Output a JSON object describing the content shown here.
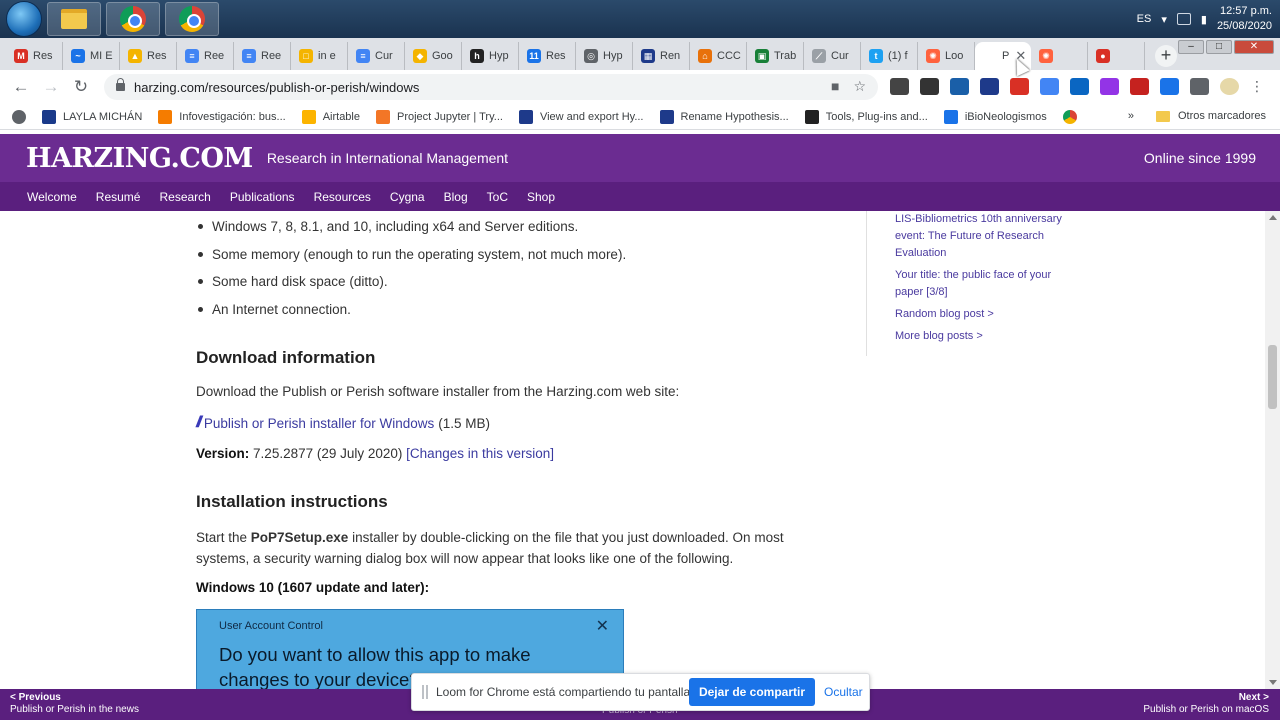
{
  "taskbar": {
    "language": "ES",
    "time": "12:57 p.m.",
    "date": "25/08/2020"
  },
  "tabs": [
    {
      "label": "Res",
      "color": "#d93025",
      "glyph": "M"
    },
    {
      "label": "MI E",
      "color": "#1a73e8",
      "glyph": "~"
    },
    {
      "label": "Res",
      "color": "#f4b400",
      "glyph": "▲"
    },
    {
      "label": "Ree",
      "color": "#4285f4",
      "glyph": "≡"
    },
    {
      "label": "Ree",
      "color": "#4285f4",
      "glyph": "≡"
    },
    {
      "label": "in e",
      "color": "#f4b400",
      "glyph": "□"
    },
    {
      "label": "Cur",
      "color": "#4285f4",
      "glyph": "≡"
    },
    {
      "label": "Goo",
      "color": "#f4b400",
      "glyph": "◆"
    },
    {
      "label": "Hyp",
      "color": "#222222",
      "glyph": "h"
    },
    {
      "label": "Res",
      "color": "#1a73e8",
      "glyph": "11"
    },
    {
      "label": "Hyp",
      "color": "#5f6368",
      "glyph": "◎"
    },
    {
      "label": "Ren",
      "color": "#1e3a8a",
      "glyph": "▦"
    },
    {
      "label": "CCC",
      "color": "#e8710a",
      "glyph": "⌂"
    },
    {
      "label": "Trab",
      "color": "#188038",
      "glyph": "▣"
    },
    {
      "label": "Cur",
      "color": "#9aa0a6",
      "glyph": "⟋"
    },
    {
      "label": "(1) f",
      "color": "#1da1f2",
      "glyph": "t"
    },
    {
      "label": "Loo",
      "color": "#ff623e",
      "glyph": "✺"
    },
    {
      "label": "P",
      "color": "#ffffff",
      "glyph": "",
      "active": true
    },
    {
      "label": "",
      "color": "#ff623e",
      "glyph": "✺"
    },
    {
      "label": "",
      "color": "#d93025",
      "glyph": "●"
    }
  ],
  "address": {
    "url": "harzing.com/resources/publish-or-perish/windows"
  },
  "bookmarks": [
    {
      "label": "LAYLA MICHÁN",
      "color": "#1a3a8a"
    },
    {
      "label": "Infovestigación: bus...",
      "color": "#f57c00"
    },
    {
      "label": "Airtable",
      "color": "#fcb400"
    },
    {
      "label": "Project Jupyter | Try...",
      "color": "#f37626"
    },
    {
      "label": "View and export Hy...",
      "color": "#1e3a8a"
    },
    {
      "label": "Rename Hypothesis...",
      "color": "#1e3a8a"
    },
    {
      "label": "Tools, Plug-ins and...",
      "color": "#222222"
    },
    {
      "label": "iBioNeologismos",
      "color": "#1a73e8"
    }
  ],
  "bookmarks_more": "»",
  "bookmarks_other": "Otros marcadores",
  "site": {
    "logo": "HARZING.COM",
    "tagline": "Research in International Management",
    "online_since": "Online since 1999",
    "nav": [
      "Welcome",
      "Resumé",
      "Research",
      "Publications",
      "Resources",
      "Cygna",
      "Blog",
      "ToC",
      "Shop"
    ]
  },
  "main": {
    "requirements": [
      "Windows 7, 8, 8.1, and 10, including x64 and Server editions.",
      "Some memory (enough to run the operating system, not much more).",
      "Some hard disk space (ditto).",
      "An Internet connection."
    ],
    "download_heading": "Download information",
    "download_text": "Download the Publish or Perish software installer from the Harzing.com web site:",
    "download_link": "Publish or Perish installer for Windows",
    "download_size": "(1.5 MB)",
    "version_label": "Version:",
    "version_value": "7.25.2877 (29 July 2020)",
    "changes_link": "[Changes in this version]",
    "install_heading": "Installation instructions",
    "install_pre": "Start the ",
    "install_file": "PoP7Setup.exe",
    "install_post": " installer by double-clicking on the file that you just downloaded. On most systems, a security warning dialog box will now appear that looks like one of the following.",
    "win10_label": "Windows 10 (1607 update and later):",
    "uac_title": "User Account Control",
    "uac_question": "Do you want to allow this app to make changes to your device?"
  },
  "sidebar": {
    "links": [
      "LIS-Bibliometrics 10th anniversary event: The Future of Research Evaluation",
      "Your title: the public face of your paper [3/8]",
      "Random blog post >",
      "More blog posts >"
    ]
  },
  "footer": {
    "prev_label": "< Previous",
    "prev_title": "Publish or Perish in the news",
    "middle": "Publish or Perish",
    "next_label": "Next >",
    "next_title": "Publish or Perish on macOS"
  },
  "loom": {
    "message": "Loom for Chrome está compartiendo tu pantalla.",
    "stop_label": "Dejar de compartir",
    "hide_label": "Ocultar"
  }
}
